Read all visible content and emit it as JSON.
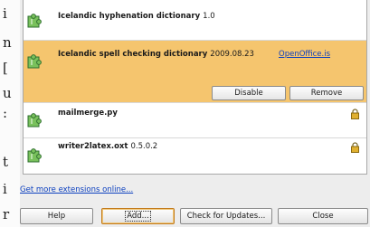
{
  "background_text": [
    "i",
    "n",
    "[",
    "u",
    ":",
    "t",
    "i",
    "r"
  ],
  "extensions": [
    {
      "name": "Icelandic hyphenation dictionary",
      "version": "1.0"
    },
    {
      "name": "Icelandic spell checking dictionary",
      "version": "2009.08.23",
      "link": "OpenOffice.is",
      "buttons": {
        "disable": "Disable",
        "remove": "Remove"
      }
    },
    {
      "name": "mailmerge.py",
      "version": ""
    },
    {
      "name": "writer2latex.oxt",
      "version": "0.5.0.2"
    }
  ],
  "more_link": "Get more extensions online...",
  "buttons": {
    "help": "Help",
    "add": "Add...",
    "check_updates": "Check for Updates...",
    "close": "Close"
  },
  "colors": {
    "selected_row": "#f5c56e",
    "link": "#0b3fbf"
  },
  "icons": [
    "puzzle-piece-icon",
    "lock-icon"
  ]
}
